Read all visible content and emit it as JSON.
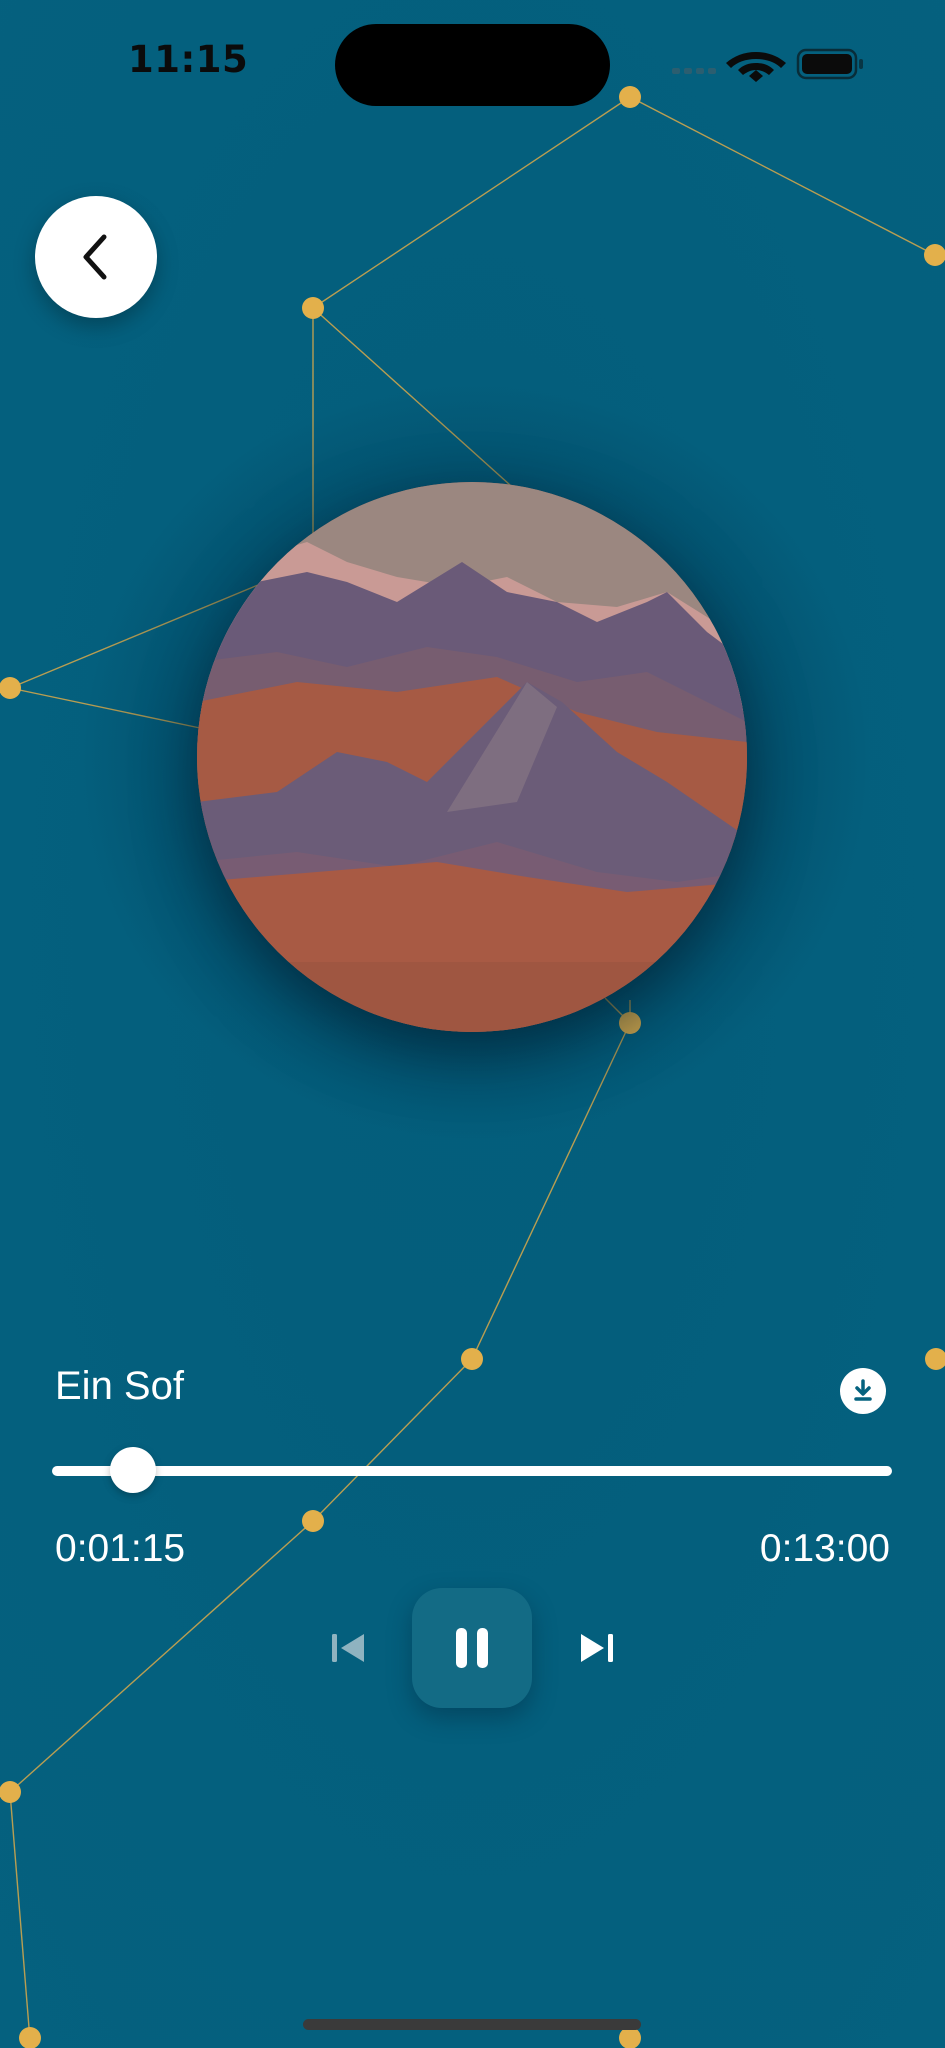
{
  "status_bar": {
    "time": "11:15"
  },
  "player": {
    "track_title": "Ein Sof",
    "elapsed": "0:01:15",
    "total": "0:13:00",
    "progress_fraction": 0.096
  },
  "icons": {
    "back": "chevron-left-icon",
    "download": "download-icon",
    "previous": "skip-previous-icon",
    "play_pause": "pause-icon",
    "next": "skip-next-icon"
  },
  "colors": {
    "background": "#04627f",
    "constellation": "#e3b04b",
    "foreground": "#ffffff",
    "play_button": "#136b85"
  }
}
